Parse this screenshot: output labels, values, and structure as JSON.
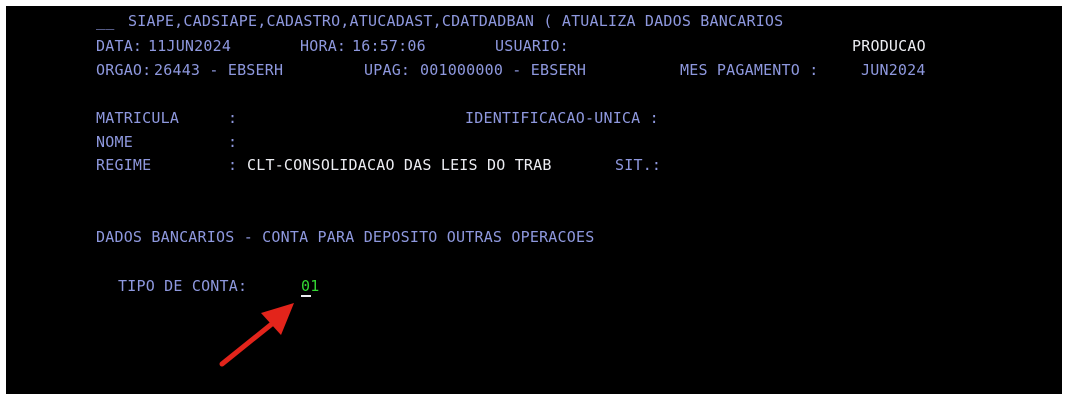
{
  "header": {
    "command_prefix": "__",
    "command": "SIAPE,CADSIAPE,CADASTRO,ATUCADAST,CDATDADBAN ( ATUALIZA DADOS BANCARIOS",
    "data_label": "DATA:",
    "data_value": "11JUN2024",
    "hora_label": "HORA:",
    "hora_value": "16:57:06",
    "usuario_label": "USUARIO:",
    "usuario_value": "",
    "environment": "PRODUCAO",
    "orgao_label": "ORGAO:",
    "orgao_value": "26443 - EBSERH",
    "upag_label": "UPAG:",
    "upag_value": "001000000 - EBSERH",
    "mes_label": "MES PAGAMENTO :",
    "mes_value": "JUN2024"
  },
  "fields": {
    "matricula_label": "MATRICULA",
    "matricula_sep": ":",
    "identificacao_label": "IDENTIFICACAO-UNICA :",
    "nome_label": "NOME",
    "nome_sep": ":",
    "regime_label": "REGIME",
    "regime_sep": ":",
    "regime_value": "CLT-CONSOLIDACAO DAS LEIS DO TRAB",
    "sit_label": "SIT.:"
  },
  "bank": {
    "section_title": "DADOS BANCARIOS - CONTA PARA DEPOSITO OUTRAS OPERACOES",
    "tipo_label": "TIPO DE CONTA:",
    "tipo_value": "01"
  },
  "colors": {
    "background": "#000000",
    "label": "#8e98de",
    "value": "#ecedf2",
    "input": "#33d633",
    "annotation_arrow": "#e3241b"
  },
  "annotation": {
    "icon": "red-arrow-icon"
  }
}
